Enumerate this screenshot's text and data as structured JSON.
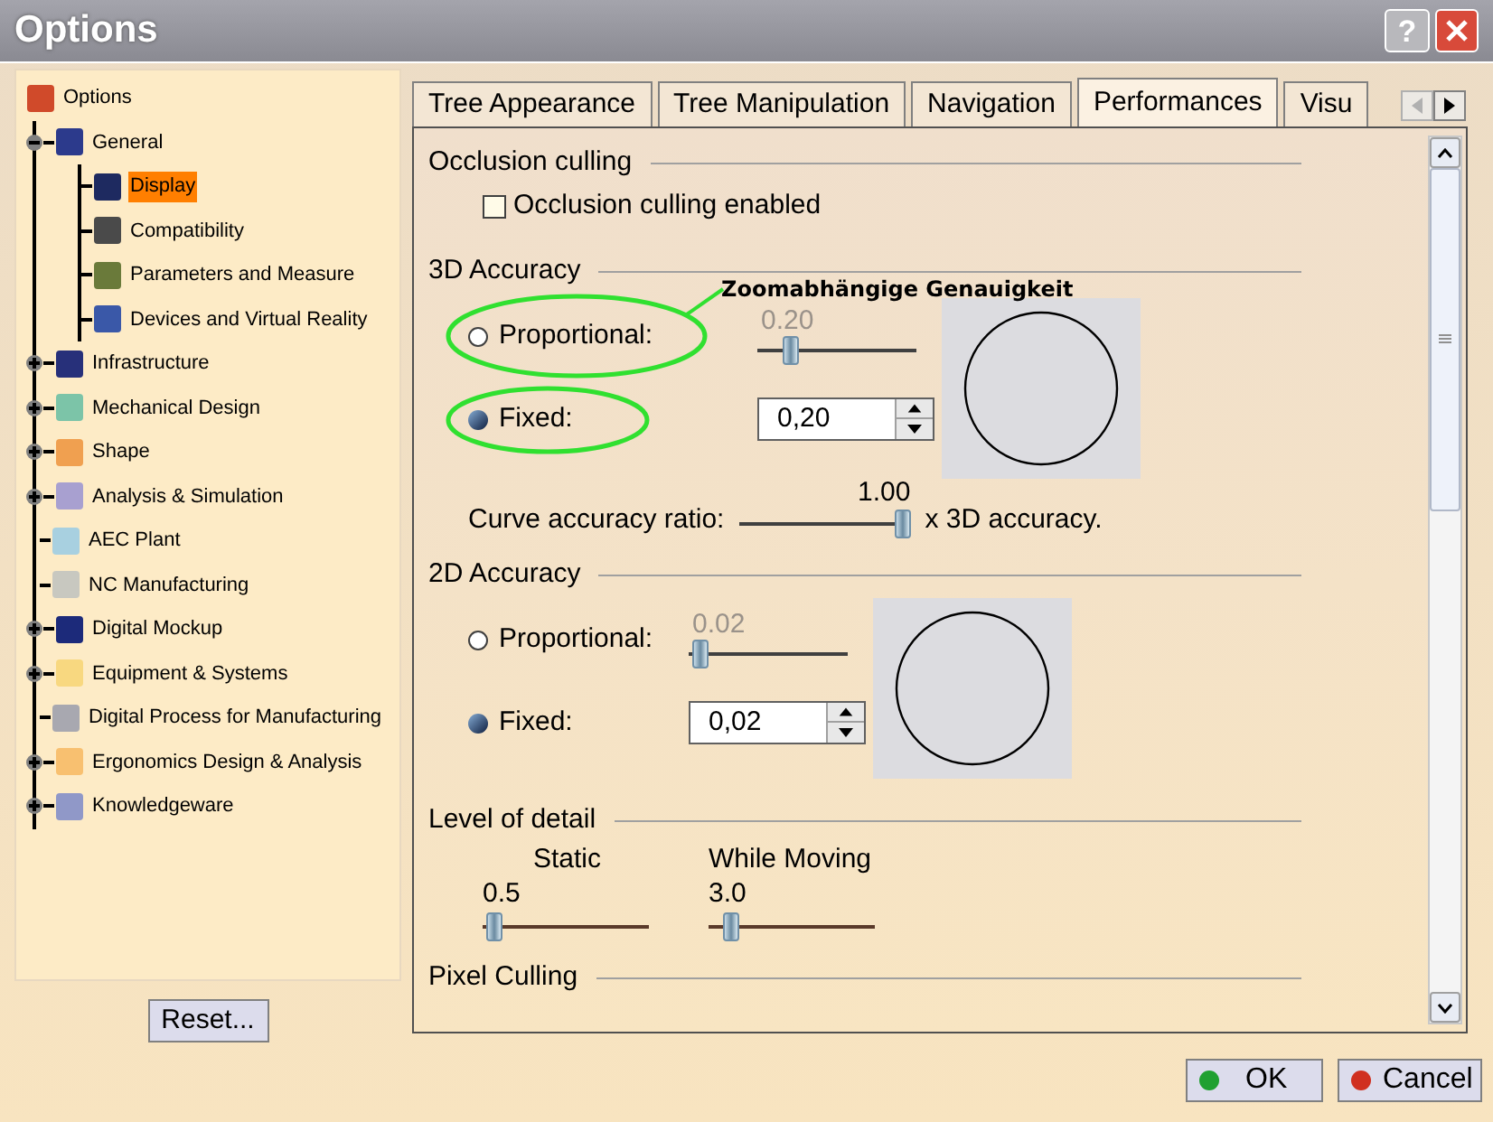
{
  "window": {
    "title": "Options",
    "help_button": "?"
  },
  "tree": {
    "label": "Options",
    "color": "#d04a2a",
    "children": [
      {
        "label": "General",
        "expanded": true,
        "selected": false,
        "color": "#2c3a8c",
        "children": [
          {
            "label": "Display",
            "selected": true,
            "color": "#1e2a60"
          },
          {
            "label": "Compatibility",
            "selected": false,
            "color": "#4a4a4a"
          },
          {
            "label": "Parameters and Measure",
            "selected": false,
            "color": "#6a7a3a"
          },
          {
            "label": "Devices and Virtual Reality",
            "selected": false,
            "color": "#3a58a8"
          }
        ]
      },
      {
        "label": "Infrastructure",
        "expanded": false,
        "selected": false,
        "color": "#27307a"
      },
      {
        "label": "Mechanical Design",
        "expanded": false,
        "selected": false,
        "color": "#7cc4a8"
      },
      {
        "label": "Shape",
        "expanded": false,
        "selected": false,
        "color": "#f0a050"
      },
      {
        "label": "Analysis & Simulation",
        "expanded": false,
        "selected": false,
        "color": "#a8a0d0"
      },
      {
        "label": "AEC Plant",
        "selected": false,
        "color": "#a8d0e0"
      },
      {
        "label": "NC Manufacturing",
        "selected": false,
        "color": "#c8c8c0"
      },
      {
        "label": "Digital Mockup",
        "expanded": false,
        "selected": false,
        "color": "#1c2a7a"
      },
      {
        "label": "Equipment & Systems",
        "expanded": false,
        "selected": false,
        "color": "#f8d880"
      },
      {
        "label": "Digital Process for Manufacturing",
        "selected": false,
        "color": "#a8a8b0"
      },
      {
        "label": "Ergonomics Design & Analysis",
        "expanded": false,
        "selected": false,
        "color": "#f8c070"
      },
      {
        "label": "Knowledgeware",
        "expanded": false,
        "selected": false,
        "color": "#9098c8"
      }
    ]
  },
  "reset_button": "Reset...",
  "tabs": [
    {
      "label": "Tree Appearance",
      "selected": false
    },
    {
      "label": "Tree Manipulation",
      "selected": false
    },
    {
      "label": "Navigation",
      "selected": false
    },
    {
      "label": "Performances",
      "selected": true
    },
    {
      "label": "Visu",
      "selected": false
    }
  ],
  "sections": [
    {
      "kind": "checkbox",
      "title": "Occlusion culling",
      "checkbox": {
        "label": "Occlusion culling enabled",
        "checked": false
      }
    },
    {
      "kind": "accuracy",
      "title": "3D Accuracy",
      "proportional": {
        "label": "Proportional:",
        "selected": false,
        "disabled": true,
        "value": "0.20",
        "level": 0.18
      },
      "fixed": {
        "label": "Fixed:",
        "selected": true,
        "value": "0,20"
      },
      "ratio": {
        "label": "Curve accuracy ratio:",
        "value": "1.00",
        "level": 1,
        "suffix": "x 3D accuracy."
      }
    },
    {
      "kind": "accuracy",
      "title": "2D Accuracy",
      "proportional": {
        "label": "Proportional:",
        "selected": false,
        "disabled": true,
        "value": "0.02",
        "level": 0.03
      },
      "fixed": {
        "label": "Fixed:",
        "selected": true,
        "value": "0,02"
      }
    },
    {
      "kind": "sliders",
      "title": "Level of detail",
      "sliders": [
        {
          "label": "Static",
          "value": "0.5",
          "level": 0.02
        },
        {
          "label": "While Moving",
          "value": "3.0",
          "level": 0.1
        }
      ]
    },
    {
      "kind": "heading",
      "title": "Pixel Culling"
    }
  ],
  "annotation": {
    "label": "Zoomabhängige Genauigkeit"
  },
  "buttons": [
    {
      "kind": "ok",
      "label": "OK"
    },
    {
      "kind": "cancel",
      "label": "Cancel"
    }
  ]
}
